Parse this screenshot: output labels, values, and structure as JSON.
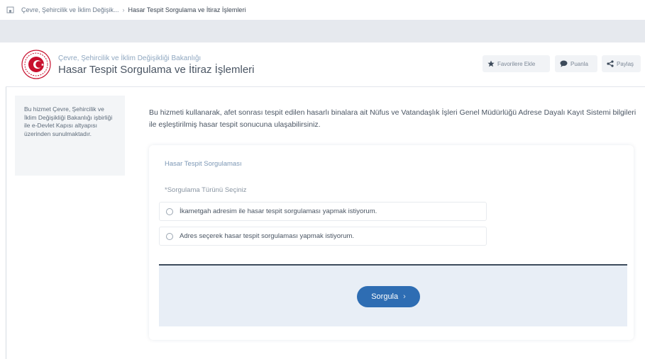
{
  "breadcrumb": {
    "items": [
      "Çevre, Şehircilik ve İklim Değişik...",
      "Hasar Tespit Sorgulama ve İtiraz İşlemleri"
    ]
  },
  "header": {
    "ministry": "Çevre, Şehircilik ve İklim Değişikliği Bakanlığı",
    "title": "Hasar Tespit Sorgulama ve İtiraz İşlemleri",
    "buttons": {
      "favorites": "Favorilere Ekle",
      "rate": "Puanla",
      "share": "Paylaş"
    }
  },
  "sidebar": {
    "text": "Bu hizmet Çevre, Şehircilik ve İklim Değişikliği Bakanlığı işbirliği ile e-Devlet Kapısı altyapısı üzerinden sunulmaktadır."
  },
  "main": {
    "intro": "Bu hizmeti kullanarak, afet sonrası tespit edilen hasarlı binalara ait Nüfus ve Vatandaşlık İşleri Genel Müdürlüğü Adrese Dayalı Kayıt Sistemi bilgileri ile eşleştirilmiş hasar tespit sonucuna ulaşabilirsiniz.",
    "card_title": "Hasar Tespit Sorgulaması",
    "question": "*Sorgulama Türünü Seçiniz",
    "options": [
      "İkametgah adresim ile hasar tespit sorgulaması yapmak istiyorum.",
      "Adres seçerek hasar tespit sorgulaması yapmak istiyorum."
    ],
    "submit": "Sorgula"
  },
  "colors": {
    "accent": "#2e6db3",
    "footer_bg": "#e8eef6",
    "sidebar_bg": "#f3f5f7",
    "emblem": "#c8102e"
  },
  "icons": {
    "home": "home-icon",
    "favorite": "star-icon",
    "rate": "speech-bubble-icon",
    "share": "share-icon",
    "next": "chevron-right-icon"
  }
}
